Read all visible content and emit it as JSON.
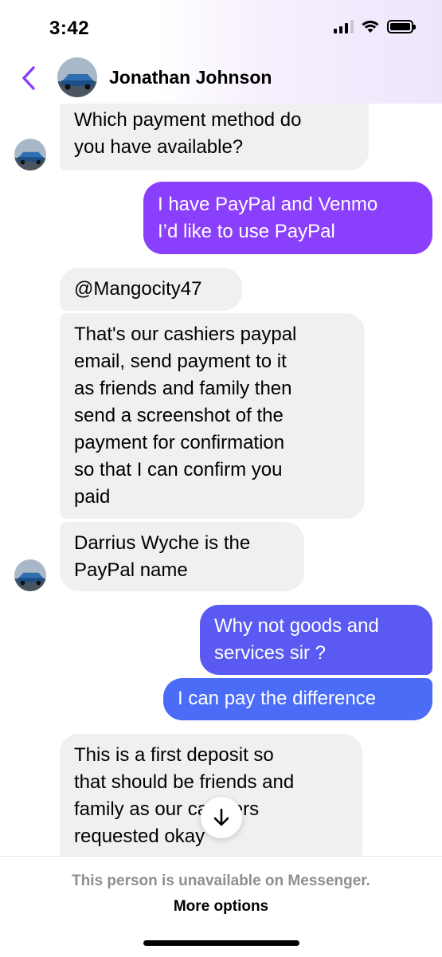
{
  "status_bar": {
    "time": "3:42"
  },
  "header": {
    "contact_name": "Jonathan Johnson",
    "back_icon": "chevron-left-icon",
    "accent": "#8a3ffc"
  },
  "colors": {
    "incoming_bg": "#f0f0f0",
    "outgoing_purple": "#8a3ffc",
    "outgoing_blue": "#4a6cf7"
  },
  "messages": [
    {
      "direction": "incoming",
      "lines": [
        "Which payment method do",
        "you have available?"
      ]
    },
    {
      "direction": "outgoing",
      "lines": [
        "I have PayPal and Venmo",
        "I’d like to use PayPal"
      ]
    },
    {
      "direction": "incoming",
      "lines": [
        "@Mangocity47"
      ]
    },
    {
      "direction": "incoming",
      "lines": [
        "That's our cashiers paypal",
        "email, send payment to it",
        "as friends and family then",
        "send a screenshot of the",
        "payment for confirmation",
        "so that I can confirm  you",
        "paid"
      ]
    },
    {
      "direction": "incoming",
      "lines": [
        "Darrius Wyche is the",
        "PayPal name"
      ]
    },
    {
      "direction": "outgoing",
      "lines": [
        "Why not goods and",
        "services sir ?"
      ]
    },
    {
      "direction": "outgoing",
      "lines": [
        "I can pay the difference"
      ]
    },
    {
      "direction": "incoming",
      "lines": [
        "This is a first deposit so",
        "that should be friends and",
        "family as our cashiers",
        "requested okay"
      ]
    }
  ],
  "scroll_button": {
    "icon": "arrow-down-icon"
  },
  "footer": {
    "unavailable_text": "This person is unavailable on Messenger.",
    "more_options_label": "More options"
  }
}
